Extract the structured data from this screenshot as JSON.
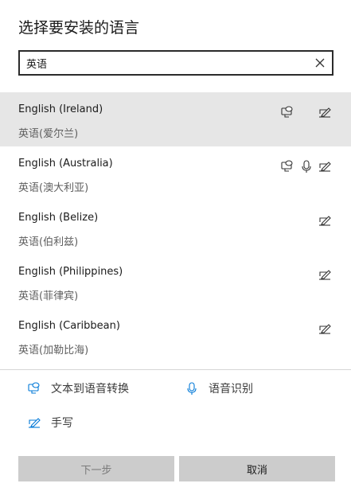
{
  "dialog": {
    "title": "选择要安装的语言"
  },
  "search": {
    "value": "英语",
    "placeholder": ""
  },
  "languages": [
    {
      "name": "English (Ireland)",
      "native": "英语(爱尔兰)",
      "tts": true,
      "speech": false,
      "handwriting": true,
      "selected": true
    },
    {
      "name": "English (Australia)",
      "native": "英语(澳大利亚)",
      "tts": true,
      "speech": true,
      "handwriting": true,
      "selected": false
    },
    {
      "name": "English (Belize)",
      "native": "英语(伯利兹)",
      "tts": false,
      "speech": false,
      "handwriting": true,
      "selected": false
    },
    {
      "name": "English (Philippines)",
      "native": "英语(菲律宾)",
      "tts": false,
      "speech": false,
      "handwriting": true,
      "selected": false
    },
    {
      "name": "English (Caribbean)",
      "native": "英语(加勒比海)",
      "tts": false,
      "speech": false,
      "handwriting": true,
      "selected": false
    }
  ],
  "legend": {
    "tts_label": "文本到语音转换",
    "speech_label": "语音识别",
    "handwriting_label": "手写"
  },
  "buttons": {
    "next_label": "下一步",
    "cancel_label": "取消"
  },
  "icons": {
    "tts": "text-to-speech-icon",
    "speech": "microphone-icon",
    "handwriting": "handwriting-icon",
    "clear": "close-icon"
  },
  "colors": {
    "accent": "#0078d7",
    "selected_row": "#e6e6e6",
    "button_bg": "#cccccc"
  }
}
